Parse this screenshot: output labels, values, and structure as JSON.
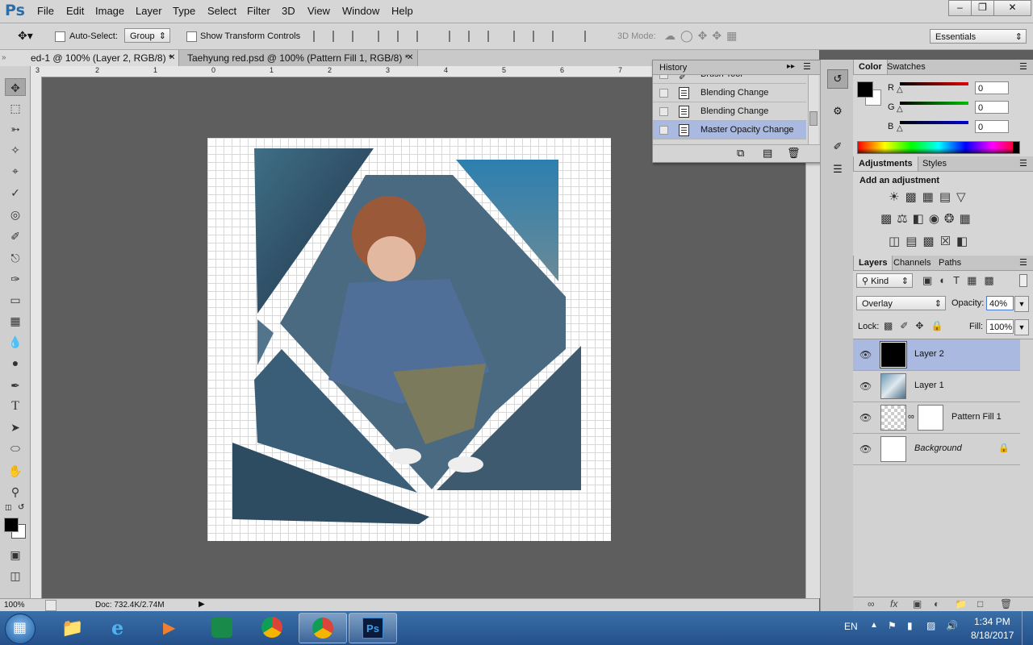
{
  "app": {
    "logo": "Ps"
  },
  "menubar": {
    "items": [
      "File",
      "Edit",
      "Image",
      "Layer",
      "Type",
      "Select",
      "Filter",
      "3D",
      "View",
      "Window",
      "Help"
    ]
  },
  "optionsbar": {
    "auto_select_label": "Auto-Select:",
    "auto_select_value": "Group",
    "transform_label": "Show Transform Controls",
    "mode3d_label": "3D Mode:",
    "workspace": "Essentials"
  },
  "tabs": [
    {
      "label": "ed-1 @ 100% (Layer 2, RGB/8) *",
      "active": true
    },
    {
      "label": "Taehyung red.psd @ 100% (Pattern Fill 1, RGB/8) *",
      "active": false
    }
  ],
  "ruler": {
    "labels": [
      "3",
      "2",
      "1",
      "0",
      "1",
      "2",
      "3",
      "4",
      "5",
      "6",
      "7"
    ]
  },
  "status": {
    "zoom": "100%",
    "doc": "Doc: 732.4K/2.74M"
  },
  "history": {
    "title": "History",
    "items": [
      {
        "label": "Brush Tool",
        "selected": false
      },
      {
        "label": "Blending Change",
        "selected": false
      },
      {
        "label": "Blending Change",
        "selected": false
      },
      {
        "label": "Master Opacity Change",
        "selected": true
      }
    ]
  },
  "color_panel": {
    "tabs": [
      "Color",
      "Swatches"
    ],
    "channels": [
      {
        "label": "R",
        "value": "0",
        "color": "#d00000"
      },
      {
        "label": "G",
        "value": "0",
        "color": "#00b000"
      },
      {
        "label": "B",
        "value": "0",
        "color": "#0000c8"
      }
    ]
  },
  "adjustments_panel": {
    "tabs": [
      "Adjustments",
      "Styles"
    ],
    "heading": "Add an adjustment"
  },
  "layers_panel": {
    "tabs": [
      "Layers",
      "Channels",
      "Paths"
    ],
    "filter_kind": "Kind",
    "blend_mode": "Overlay",
    "opacity_label": "Opacity:",
    "opacity_value": "40%",
    "lock_label": "Lock:",
    "fill_label": "Fill:",
    "fill_value": "100%",
    "layers": [
      {
        "name": "Layer 2",
        "selected": true,
        "thumb": "black"
      },
      {
        "name": "Layer 1",
        "selected": false,
        "thumb": "photo"
      },
      {
        "name": "Pattern Fill 1",
        "selected": false,
        "thumb": "pattern"
      },
      {
        "name": "Background",
        "selected": false,
        "thumb": "white",
        "locked": true
      }
    ]
  },
  "taskbar": {
    "language": "EN",
    "time": "1:34 PM",
    "date": "8/18/2017"
  },
  "colors": {
    "chrome": "#d6d6d6",
    "workspace": "#5e5e5e",
    "selection": "#a9b9e0",
    "taskbar": "#2b5a94"
  }
}
